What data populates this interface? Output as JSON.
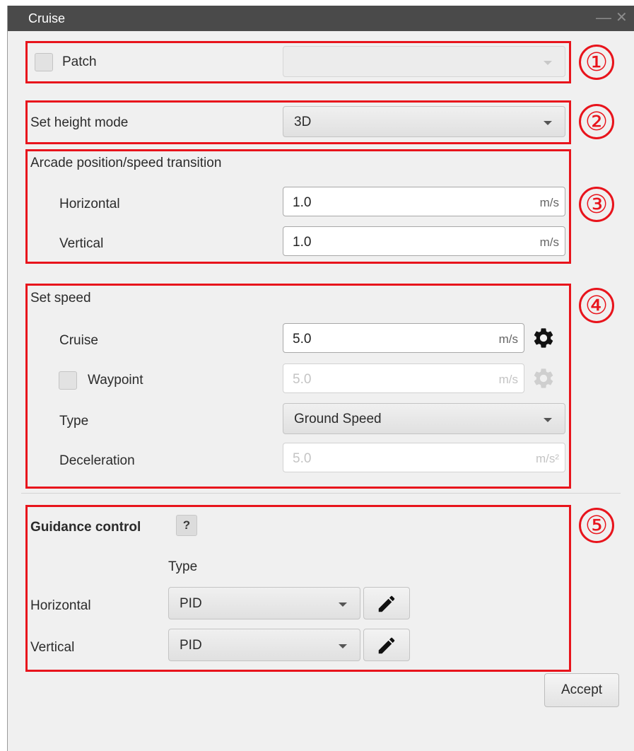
{
  "window": {
    "title": "Cruise",
    "minimize_glyph": "—",
    "close_glyph": "✕"
  },
  "annotations": [
    "①",
    "②",
    "③",
    "④",
    "⑤"
  ],
  "patch": {
    "label": "Patch",
    "checked": false,
    "combo_value": "",
    "combo_enabled": false
  },
  "height_mode": {
    "label": "Set height mode",
    "value": "3D"
  },
  "arcade": {
    "title": "Arcade position/speed transition",
    "horizontal": {
      "label": "Horizontal",
      "value": "1.0",
      "unit": "m/s"
    },
    "vertical": {
      "label": "Vertical",
      "value": "1.0",
      "unit": "m/s"
    }
  },
  "speed": {
    "title": "Set speed",
    "cruise": {
      "label": "Cruise",
      "value": "5.0",
      "unit": "m/s"
    },
    "waypoint": {
      "label": "Waypoint",
      "checked": false,
      "value": "5.0",
      "unit": "m/s"
    },
    "type": {
      "label": "Type",
      "value": "Ground Speed"
    },
    "deceleration": {
      "label": "Deceleration",
      "value": "5.0",
      "unit": "m/s²"
    }
  },
  "guidance": {
    "title": "Guidance control",
    "help_label": "?",
    "type_header": "Type",
    "horizontal": {
      "label": "Horizontal",
      "value": "PID"
    },
    "vertical": {
      "label": "Vertical",
      "value": "PID"
    }
  },
  "footer": {
    "accept_label": "Accept"
  },
  "colors": {
    "annotation_red": "#e8141c",
    "titlebar": "#4a4a4a",
    "window_bg": "#f0f0f0"
  },
  "icons": [
    "gear-icon",
    "pencil-icon",
    "chevron-down-icon",
    "close-icon",
    "minimize-icon"
  ]
}
